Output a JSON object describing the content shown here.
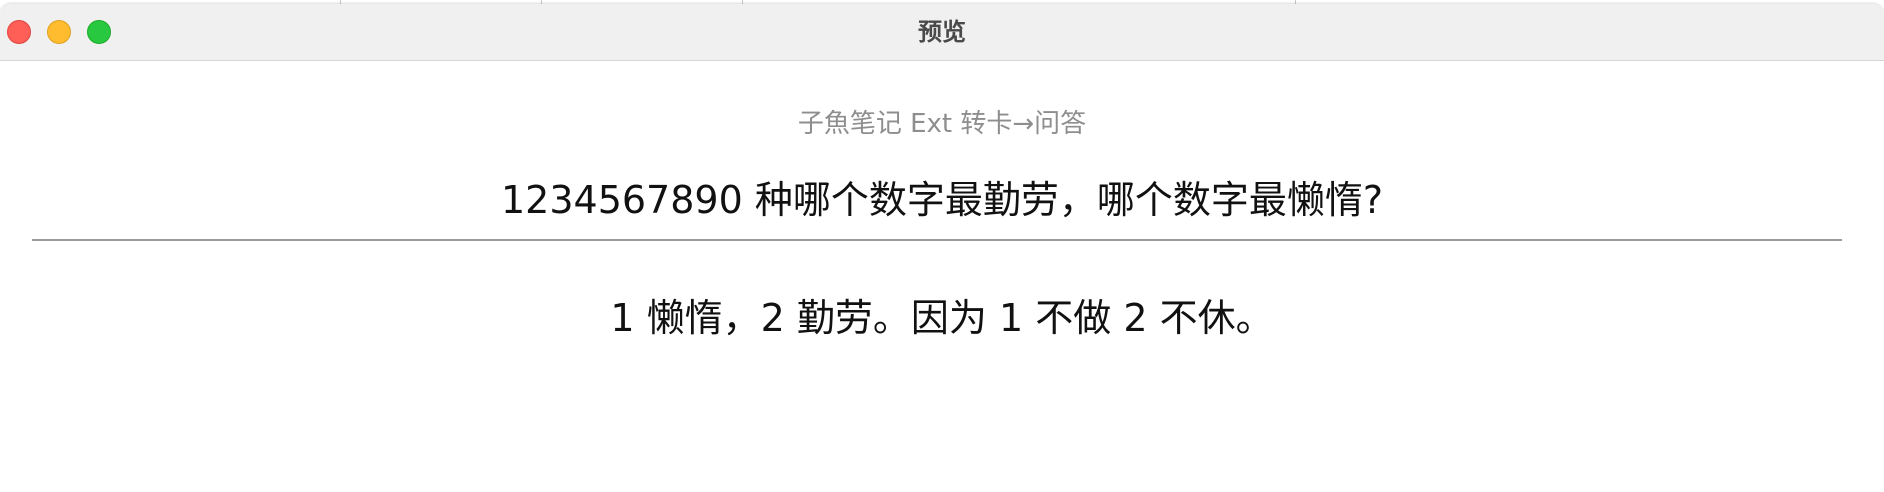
{
  "window": {
    "title": "预览"
  },
  "card": {
    "tag": "子魚笔记 Ext 转卡→问答",
    "question": "1234567890 种哪个数字最勤劳，哪个数字最懒惰?",
    "answer": "1 懒惰，2 勤劳。因为 1 不做 2 不休。"
  },
  "colors": {
    "close": "#ff5f57",
    "minimize": "#febc2e",
    "maximize": "#28c840",
    "tag_text": "#8e8e8e",
    "divider": "#9a9a9a"
  }
}
